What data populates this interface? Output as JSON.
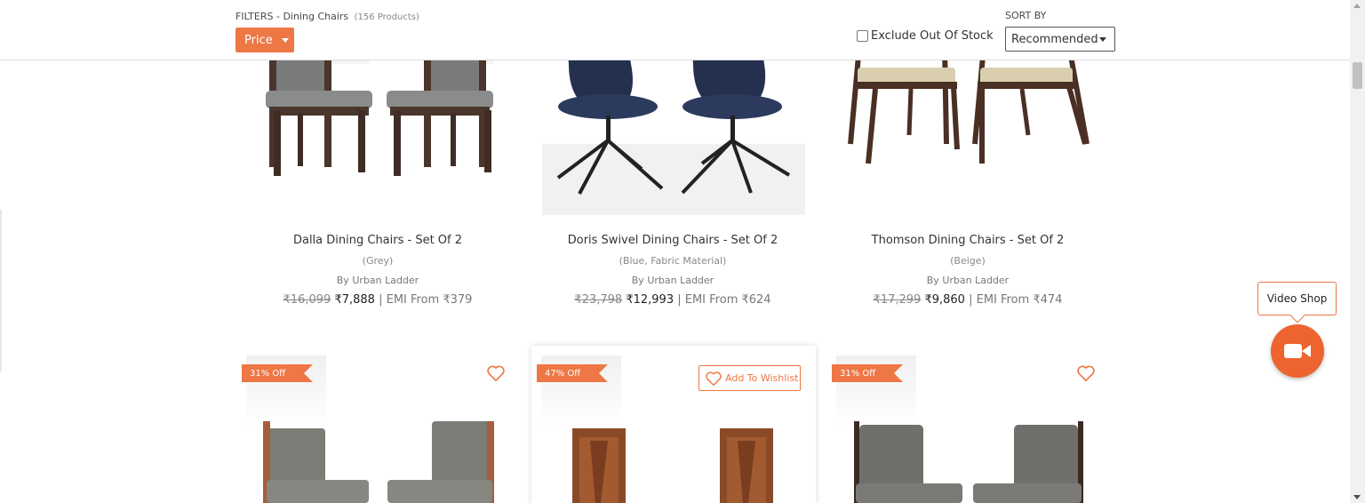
{
  "filters": {
    "label": "FILTERS - Dining Chairs",
    "count": "(156 Products)",
    "price_button": "Price",
    "exclude_label": "Exclude Out Of Stock",
    "exclude_checked": false
  },
  "sort": {
    "label": "SORT BY",
    "selected": "Recommended"
  },
  "products_row1": [
    {
      "name": "Dalla Dining Chairs - Set Of 2",
      "variant": "(Grey)",
      "brand": "By Urban Ladder",
      "old_price": "₹16,099",
      "new_price": "₹7,888",
      "emi": "| EMI From ₹379"
    },
    {
      "name": "Doris Swivel Dining Chairs - Set Of 2",
      "variant": "(Blue, Fabric Material)",
      "brand": "By Urban Ladder",
      "old_price": "₹23,798",
      "new_price": "₹12,993",
      "emi": "| EMI From ₹624"
    },
    {
      "name": "Thomson Dining Chairs - Set Of 2",
      "variant": "(Beige)",
      "brand": "By Urban Ladder",
      "old_price": "₹17,299",
      "new_price": "₹9,860",
      "emi": "| EMI From ₹474"
    }
  ],
  "products_row2": [
    {
      "discount": "31% Off"
    },
    {
      "discount": "47% Off",
      "wishlist_label": "Add To Wishlist"
    },
    {
      "discount": "31% Off"
    }
  ],
  "video_shop": {
    "label": "Video Shop"
  },
  "colors": {
    "accent": "#ed7745",
    "video_button": "#ed6430"
  }
}
